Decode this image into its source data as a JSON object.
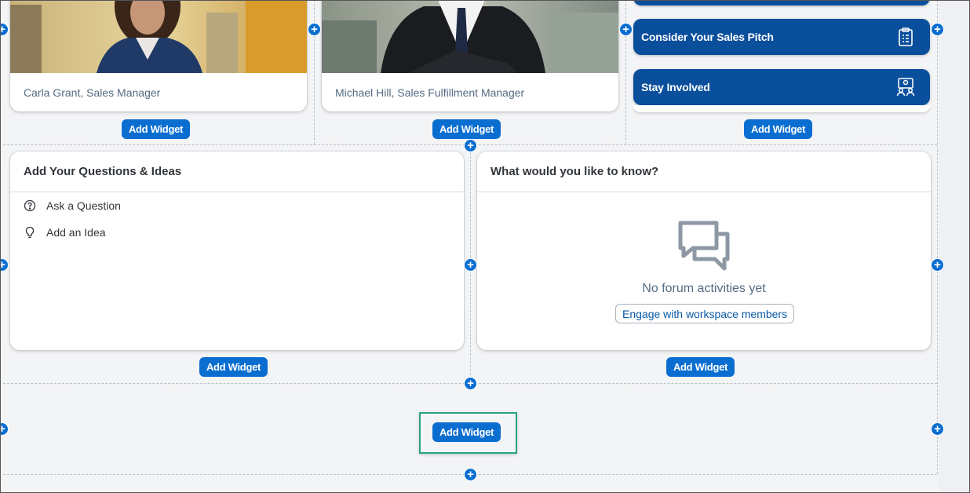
{
  "profiles": [
    {
      "caption": "Carla Grant, Sales Manager"
    },
    {
      "caption": "Michael Hill, Sales Fulfillment Manager"
    }
  ],
  "tiles": [
    {
      "label": "Consider Your Sales Pitch",
      "icon": "clipboard-icon"
    },
    {
      "label": "Stay Involved",
      "icon": "people-icon"
    }
  ],
  "add_widget_label": "Add Widget",
  "plus_label": "+",
  "questions_card": {
    "title": "Add Your Questions & Ideas",
    "items": [
      {
        "label": "Ask a Question",
        "icon": "question-circle-icon"
      },
      {
        "label": "Add an Idea",
        "icon": "lightbulb-icon"
      }
    ]
  },
  "forum_card": {
    "title": "What would you like to know?",
    "empty_text": "No forum activities yet",
    "button_label": "Engage with workspace members",
    "icon": "chat-bubbles-icon"
  },
  "colors": {
    "accent": "#0a6ed1",
    "tile": "#0a4f9c",
    "highlight": "#2aa382"
  }
}
